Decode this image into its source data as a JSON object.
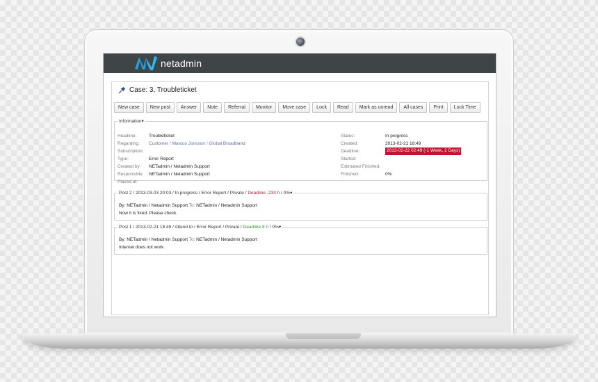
{
  "app": {
    "brand": "netadmin"
  },
  "case": {
    "title": "Case: 3, Troubleticket"
  },
  "toolbar": [
    "New case",
    "New post",
    "Answer",
    "Note",
    "Referral",
    "Monitor",
    "Move case",
    "Lock",
    "Read",
    "Mark as unread",
    "All cases",
    "Print",
    "Lock Time"
  ],
  "information": {
    "legend": "Information",
    "toggle_icon": "chevron-down-icon",
    "left": [
      {
        "label": "Headline:",
        "value": "Troubleticket"
      },
      {
        "label": "Regarding:",
        "value": "Customer / Marcus Jonsson / Global Broadband",
        "link": true
      },
      {
        "label": "Subscription:",
        "value": ""
      },
      {
        "label": "Type:",
        "value": "Error Report"
      },
      {
        "label": "Created by:",
        "value": "NETadmin / Netadmin Support"
      },
      {
        "label": "Responsible:",
        "value": "NETadmin / Netadmin Support"
      },
      {
        "label": "Placed at:",
        "value": ""
      }
    ],
    "right": [
      {
        "label": "States:",
        "value": "In progress"
      },
      {
        "label": "Created:",
        "value": "2013-02-21 18:49"
      },
      {
        "label": "Deadline:",
        "value": "2013-02-22 02:49 (-1 Week, 2 Days)",
        "badge": true
      },
      {
        "label": "Started:",
        "value": ""
      },
      {
        "label": "Estimated Finished:",
        "value": ""
      },
      {
        "label": "Finished:",
        "value": "0%"
      }
    ]
  },
  "posts": [
    {
      "legend_prefix": "Post 2 / 2013-03-03 20:03 / In progress / Error Report / Private / ",
      "deadline": "Deadline -233 h",
      "deadline_color": "#d0112b",
      "legend_suffix": " / 0%",
      "by_prefix": "By: ",
      "by": "NETadmin / Netadmin Support",
      "to_prefix": " To: ",
      "to": "NETadmin / Netadmin Support",
      "text": "Now it is fixed. Please check."
    },
    {
      "legend_prefix": "Post 1 / 2013-02-21 18:49 / Attend to / Error Report / Private / ",
      "deadline": "Deadline 8 h",
      "deadline_color": "#2aa02a",
      "legend_suffix": " / 0%",
      "by_prefix": "By: ",
      "by": "NETadmin / Netadmin Support",
      "to_prefix": " To: ",
      "to": "NETadmin / Netadmin Support",
      "text": "Internet does not work"
    }
  ]
}
